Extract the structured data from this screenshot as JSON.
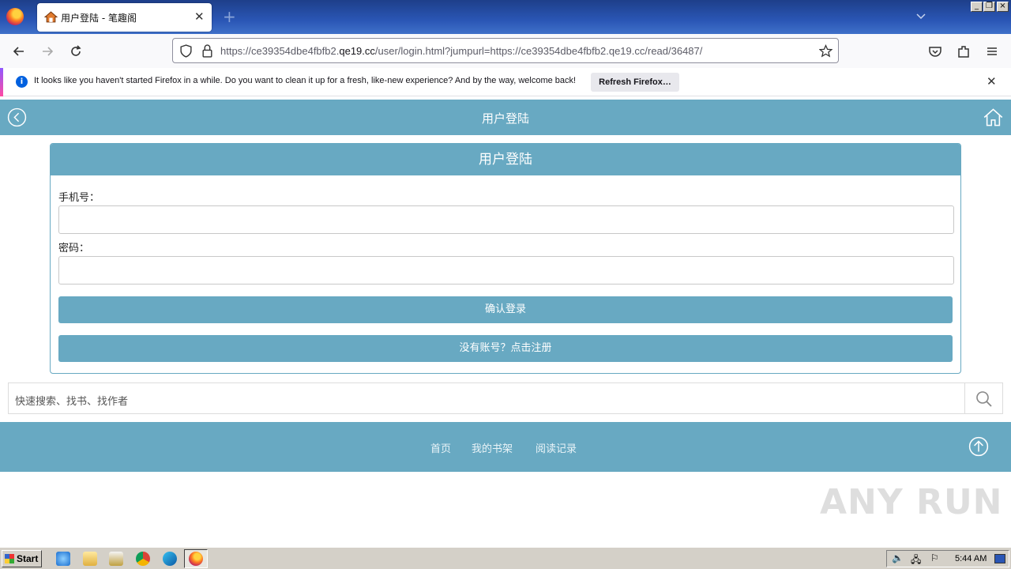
{
  "browser": {
    "tab_title": "用户登陆 - 笔趣阁",
    "url_prefix": "https://ce39354dbe4fbfb2.",
    "url_domain": "qe19.cc",
    "url_suffix": "/user/login.html?jumpurl=https://ce39354dbe4fbfb2.qe19.cc/read/36487/",
    "notification": {
      "text": "It looks like you haven't started Firefox in a while. Do you want to clean it up for a fresh, like-new experience? And by the way, welcome back!",
      "button": "Refresh Firefox…"
    }
  },
  "page": {
    "header_title": "用户登陆",
    "card_title": "用户登陆",
    "phone_label": "手机号：",
    "password_label": "密码：",
    "login_button": "确认登录",
    "register_button": "没有账号？点击注册",
    "search_placeholder": "快速搜索、找书、找作者",
    "footer_links": [
      "首页",
      "我的书架",
      "阅读记录"
    ],
    "watermark": "ANY RUN"
  },
  "taskbar": {
    "start_label": "Start",
    "clock": "5:44 AM"
  },
  "colors": {
    "accent": "#68a9c2",
    "browser_titlebar": "#2a56b5"
  }
}
